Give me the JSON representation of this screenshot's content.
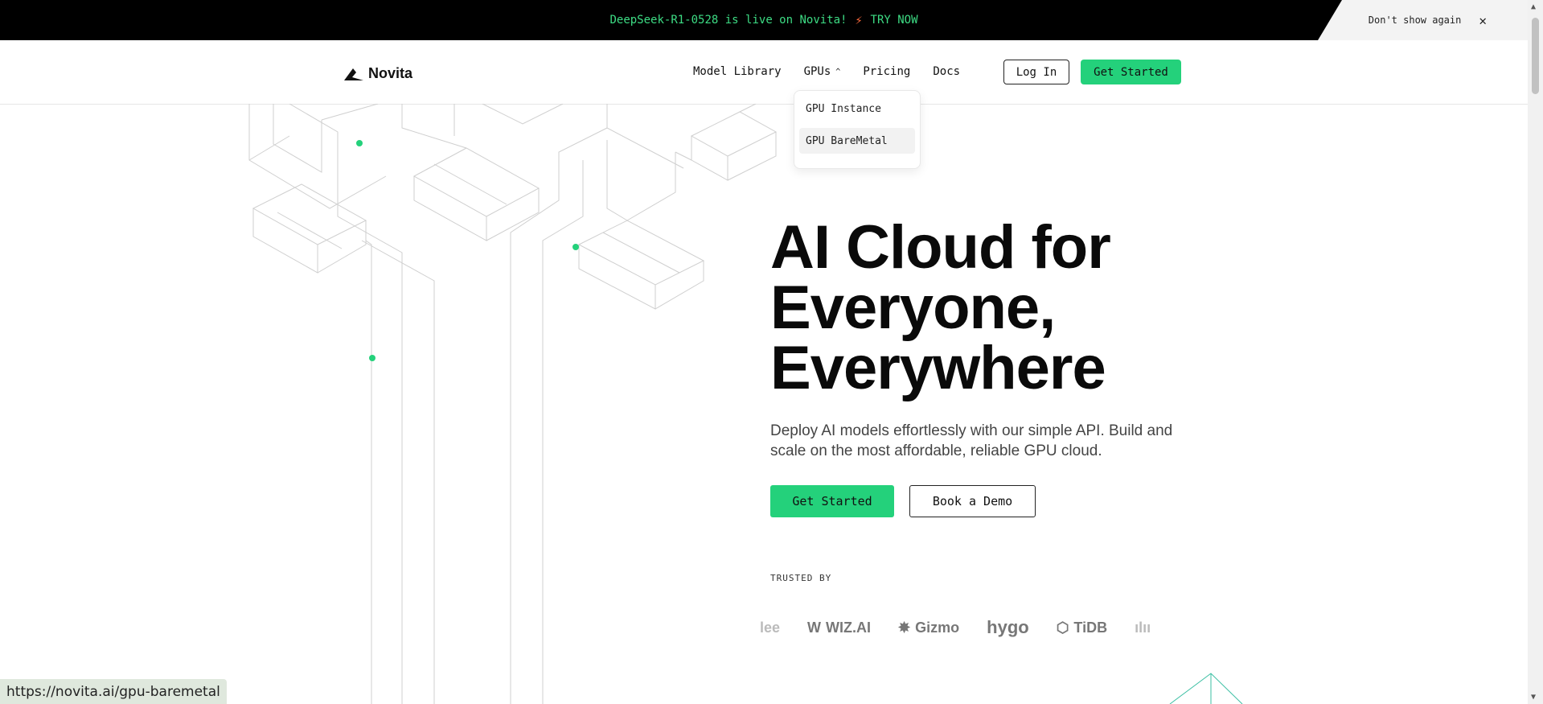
{
  "announcement": {
    "message": "DeepSeek-R1-0528 is live on Novita!",
    "cta": "TRY NOW",
    "dismiss_label": "Don't show again"
  },
  "nav": {
    "logo_text": "Novita",
    "items": [
      {
        "label": "Model Library"
      },
      {
        "label": "GPUs"
      },
      {
        "label": "Pricing"
      },
      {
        "label": "Docs"
      }
    ],
    "login_label": "Log In",
    "get_started_label": "Get Started"
  },
  "gpu_dropdown": {
    "options": [
      {
        "label": "GPU Instance"
      },
      {
        "label": "GPU BareMetal"
      }
    ]
  },
  "hero": {
    "title_line1": "AI Cloud for",
    "title_line2": "Everyone,",
    "title_line3": "Everywhere",
    "subtitle": "Deploy AI models effortlessly with our simple API. Build and scale on the most affordable, reliable GPU cloud.",
    "primary_cta": "Get Started",
    "secondary_cta": "Book a Demo"
  },
  "trusted": {
    "label": "TRUSTED BY",
    "logos": [
      "lee",
      "WIZ.AI",
      "Gizmo",
      "hygo",
      "TiDB"
    ]
  },
  "status_url": "https://novita.ai/gpu-baremetal",
  "colors": {
    "accent": "#24d17b",
    "announcement_bg": "#000000",
    "announcement_text": "#3ddc84"
  }
}
